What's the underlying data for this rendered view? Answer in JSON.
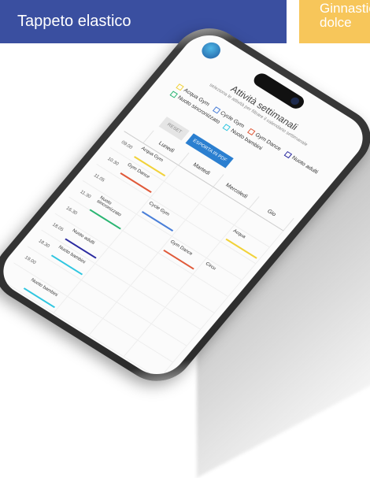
{
  "tabs": [
    {
      "label": "Tappeto elastico",
      "color": "#3a4fa0"
    },
    {
      "label": "Ginnastica dolce",
      "color": "#f7c65a"
    }
  ],
  "app": {
    "title": "Attività settimanali",
    "subtitle": "seleziona le attività per filtrare il calendario settimanale",
    "legend": [
      {
        "label": "Acqua Gym",
        "color": "#f1d23a"
      },
      {
        "label": "Cycle Gym",
        "color": "#4a7fd8"
      },
      {
        "label": "Gym Dance",
        "color": "#e05a3a"
      },
      {
        "label": "Nuoto adulti",
        "color": "#2a2aa0"
      },
      {
        "label": "Nuoto sincronizzato",
        "color": "#2bb673"
      },
      {
        "label": "Nuoto bambini",
        "color": "#30c6e0"
      }
    ],
    "buttons": {
      "reset": "RESET",
      "pdf": "ESPORTA IN PDF"
    },
    "days": [
      "Lunedì",
      "Martedì",
      "Mercoledì",
      "Gio"
    ],
    "rows": [
      {
        "time": "09.00",
        "cells": [
          "Acqua Gym",
          "",
          "",
          ""
        ]
      },
      {
        "time": "10.30",
        "cells": [
          "Gym Dance",
          "",
          "",
          "Acqua"
        ]
      },
      {
        "time": "11.05",
        "cells": [
          "",
          "Cycle Gym",
          "",
          ""
        ]
      },
      {
        "time": "11.30",
        "cells": [
          "Nuoto sincronizzato",
          "",
          "Gym Dance",
          "Circu"
        ]
      },
      {
        "time": "16.30",
        "cells": [
          "",
          "",
          "",
          ""
        ]
      },
      {
        "time": "18.05",
        "cells": [
          "Nuoto adulti",
          "",
          "",
          ""
        ]
      },
      {
        "time": "18.30",
        "cells": [
          "Nuoto bambini",
          "",
          "",
          ""
        ]
      },
      {
        "time": "19.00",
        "cells": [
          "",
          "",
          "",
          ""
        ]
      },
      {
        "time": "",
        "cells": [
          "Nuoto bambini",
          "",
          "",
          ""
        ]
      }
    ]
  }
}
